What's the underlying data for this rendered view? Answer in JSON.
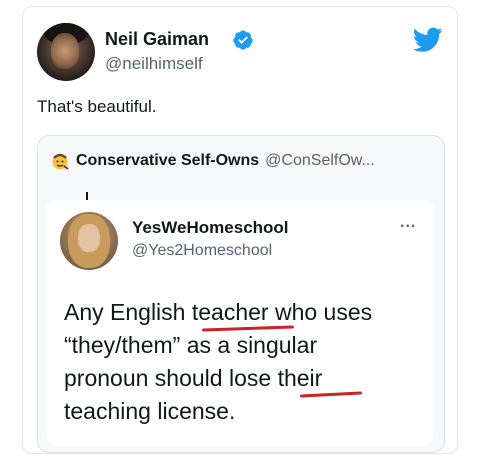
{
  "tweet": {
    "author_name": "Neil Gaiman",
    "author_handle": "@neilhimself",
    "text": "That's beautiful."
  },
  "quote": {
    "author_name": "Conservative Self-Owns",
    "author_handle": "@ConSelfOw..."
  },
  "inner_tweet": {
    "author_name": "YesWeHomeschool",
    "author_handle": "@Yes2Homeschool",
    "more": "...",
    "line1_a": "Any English ",
    "line1_b": "teacher",
    "line1_c": " who uses",
    "line2": "“they/them” as a singular",
    "line3_a": "pronoun should lose ",
    "line3_b": "their",
    "line4": "teaching license."
  },
  "colors": {
    "twitter_blue": "#1d9bf0",
    "underline_red": "#d0202a",
    "secondary_text": "#536471"
  },
  "icons": {
    "verified": "verified-badge-icon",
    "brand": "twitter-bird-icon",
    "quote_avatar": "emoji-face-icon"
  }
}
